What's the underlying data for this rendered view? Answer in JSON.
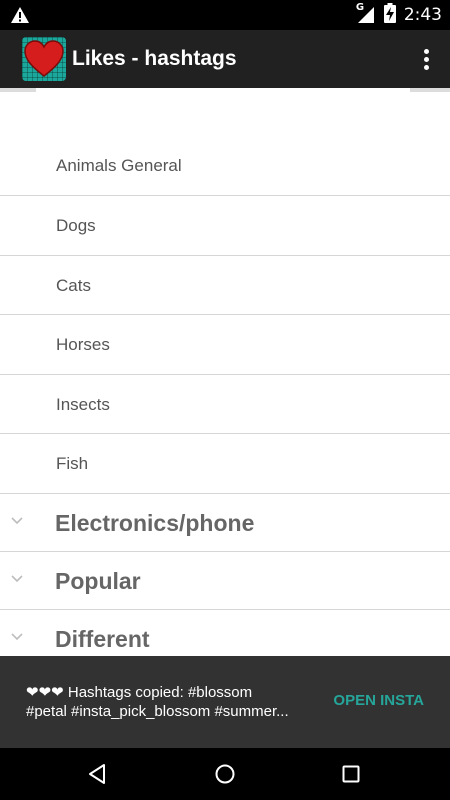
{
  "status_bar": {
    "time": "2:43",
    "network_label": "G",
    "icons": [
      "warning-icon",
      "signal-icon",
      "battery-charging-icon"
    ]
  },
  "app_bar": {
    "title": "Likes - hashtags",
    "logo_icon": "heart-logo-icon",
    "menu_icon": "more-vert-icon"
  },
  "list": {
    "children": [
      {
        "label": "Animals General"
      },
      {
        "label": "Dogs"
      },
      {
        "label": "Cats"
      },
      {
        "label": "Horses"
      },
      {
        "label": "Insects"
      },
      {
        "label": "Fish"
      }
    ],
    "groups": [
      {
        "label": "Electronics/phone",
        "expanded": false
      },
      {
        "label": "Popular",
        "expanded": false
      },
      {
        "label": "Different",
        "expanded": false
      }
    ]
  },
  "snackbar": {
    "line1": "❤❤❤ Hashtags copied: #blossom",
    "line2": "#petal #insta_pick_blossom #summer...",
    "action_label": "OPEN INSTA",
    "action_color": "#26a69a"
  },
  "nav_bar": {
    "icons": [
      "back-icon",
      "home-icon",
      "recents-icon"
    ]
  },
  "colors": {
    "app_bar_bg": "#212121",
    "content_bg": "#ffffff",
    "snackbar_bg": "#323232",
    "logo_bg": "#1ba79b",
    "heart": "#d61d1d"
  }
}
